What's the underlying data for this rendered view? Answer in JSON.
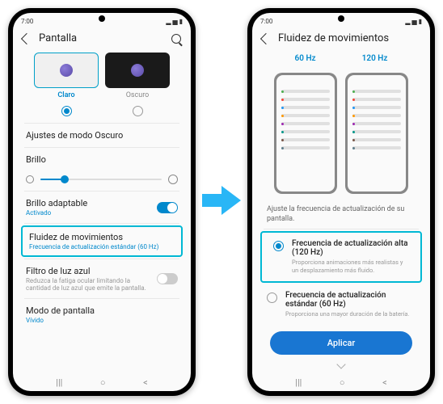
{
  "status": {
    "time": "7:00",
    "icons": "◧ ▮▮ ⚡"
  },
  "left": {
    "title": "Pantalla",
    "themes": {
      "light": "Claro",
      "dark": "Oscuro"
    },
    "dark_mode": "Ajustes de modo Oscuro",
    "brightness": "Brillo",
    "adaptive": {
      "title": "Brillo adaptable",
      "sub": "Activado"
    },
    "fluidity": {
      "title": "Fluidez de movimientos",
      "sub": "Frecuencia de actualización estándar (60 Hz)"
    },
    "bluelight": {
      "title": "Filtro de luz azul",
      "sub": "Reduzca la fatiga ocular limitando la cantidad de luz azul que emite la pantalla."
    },
    "screenmode": {
      "title": "Modo de pantalla",
      "sub": "Vívido"
    }
  },
  "right": {
    "title": "Fluidez de movimientos",
    "tab60": "60 Hz",
    "tab120": "120 Hz",
    "desc": "Ajuste la frecuencia de actualización de su pantalla.",
    "opt1": {
      "title": "Frecuencia de actualización alta (120 Hz)",
      "sub": "Proporciona animaciones más realistas y un desplazamiento más fluido."
    },
    "opt2": {
      "title": "Frecuencia de actualización estándar (60 Hz)",
      "sub": "Proporciona una mayor duración de la batería."
    },
    "apply": "Aplicar"
  }
}
